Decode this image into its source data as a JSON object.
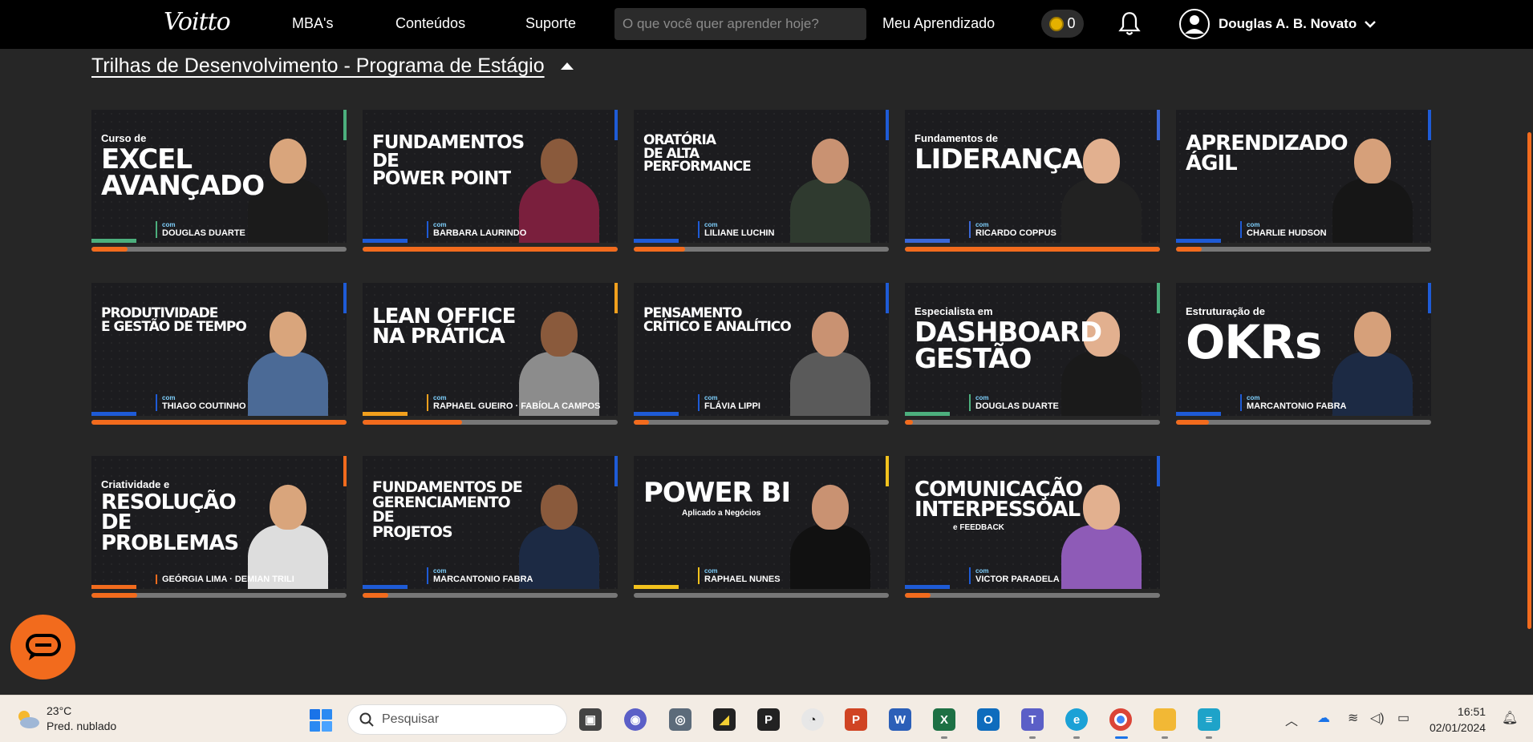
{
  "nav": {
    "logo": "Voitto",
    "links": [
      "MBA's",
      "Conteúdos",
      "Suporte"
    ],
    "search_placeholder": "O que você quer aprender hoje?",
    "my_learning": "Meu Aprendizado",
    "coins": "0",
    "user_name": "Douglas A. B. Novato"
  },
  "section": {
    "title": "Trilhas de Desenvolvimento - Programa de Estágio"
  },
  "courses": [
    {
      "small": "Curso de",
      "big": "EXCEL\nAVANÇADO",
      "com": "com",
      "presenter": "DOUGLAS DUARTE",
      "accent": "#4caf7d",
      "progress": 0.14
    },
    {
      "small": "",
      "big": "FUNDAMENTOS DE\nPOWER POINT",
      "com": "com",
      "presenter": "BARBARA LAURINDO",
      "accent": "#1e5bd6",
      "progress": 1.0
    },
    {
      "small": "",
      "big": "ORATÓRIA\nDE ALTA PERFORMANCE",
      "com": "com",
      "presenter": "LILIANE LUCHIN",
      "accent": "#1e5bd6",
      "progress": 0.2
    },
    {
      "small": "Fundamentos de",
      "big": "LIDERANÇA",
      "com": "com",
      "presenter": "RICARDO COPPUS",
      "accent": "#3b67d6",
      "progress": 1.0
    },
    {
      "small": "",
      "big": "APRENDIZADO\nÁGIL",
      "com": "com",
      "presenter": "CHARLIE HUDSON",
      "accent": "#1e5bd6",
      "progress": 0.1
    },
    {
      "small": "",
      "big": "PRODUTIVIDADE\nE GESTÃO DE TEMPO",
      "com": "com",
      "presenter": "THIAGO COUTINHO",
      "accent": "#1e5bd6",
      "progress": 1.0
    },
    {
      "small": "",
      "big": "LEAN OFFICE\nNA PRÁTICA",
      "com": "com",
      "presenter": "RAPHAEL GUEIRO · FABÍOLA CAMPOS",
      "accent": "#f2a01d",
      "progress": 0.39
    },
    {
      "small": "",
      "big": "PENSAMENTO\nCRÍTICO E ANALÍTICO",
      "com": "com",
      "presenter": "FLÁVIA LIPPI",
      "accent": "#1e5bd6",
      "progress": 0.06
    },
    {
      "small": "Especialista em",
      "big": "DASHBOARD\nGESTÃO",
      "com": "com",
      "presenter": "DOUGLAS DUARTE",
      "accent": "#4caf7d",
      "progress": 0.03
    },
    {
      "small": "Estruturação de",
      "big": "OKRs",
      "com": "com",
      "presenter": "MARCANTONIO FABRA",
      "accent": "#1e5bd6",
      "progress": 0.13
    },
    {
      "small": "Criatividade e",
      "big": "RESOLUÇÃO DE\nPROBLEMAS",
      "com": "",
      "presenter": "GEÓRGIA LIMA · DEMIAN TRILI",
      "accent": "#f26b1d",
      "progress": 0.18
    },
    {
      "small": "",
      "big": "FUNDAMENTOS DE\nGERENCIAMENTO DE\nPROJETOS",
      "com": "com",
      "presenter": "MARCANTONIO FABRA",
      "accent": "#1e5bd6",
      "progress": 0.1
    },
    {
      "small": "",
      "big": "POWER BI",
      "com": "com",
      "presenter": "RAPHAEL NUNES",
      "accent": "#f2c21d",
      "progress": 0.0,
      "sub": "Aplicado a Negócios"
    },
    {
      "small": "",
      "big": "COMUNICAÇÃO\nINTERPESSOAL",
      "com": "com",
      "presenter": "VICTOR PARADELA",
      "accent": "#1e5bd6",
      "progress": 0.1,
      "sub": "e FEEDBACK"
    }
  ],
  "taskbar": {
    "temp": "23°C",
    "weather": "Pred. nublado",
    "search": "Pesquisar",
    "time": "16:51",
    "date": "02/01/2024"
  }
}
